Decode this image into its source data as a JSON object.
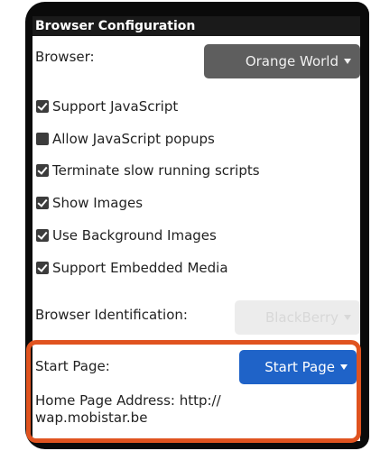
{
  "window": {
    "title": "Browser Configuration"
  },
  "browser": {
    "label": "Browser:",
    "value": "Orange World"
  },
  "options": [
    {
      "label": "Support JavaScript",
      "checked": true
    },
    {
      "label": "Allow JavaScript popups",
      "checked": false
    },
    {
      "label": "Terminate slow running scripts",
      "checked": true
    },
    {
      "label": "Show Images",
      "checked": true
    },
    {
      "label": "Use Background Images",
      "checked": true
    },
    {
      "label": "Support Embedded Media",
      "checked": true
    }
  ],
  "identification": {
    "label": "Browser Identification:",
    "value": "BlackBerry",
    "enabled": false
  },
  "start_page": {
    "label": "Start Page:",
    "value": "Start Page"
  },
  "home_page": {
    "text": "Home Page Address: http:// wap.mobistar.be"
  },
  "colors": {
    "highlight": "#e0531f",
    "blue_dropdown": "#1f63c8",
    "gray_dropdown": "#5e5e5e"
  }
}
